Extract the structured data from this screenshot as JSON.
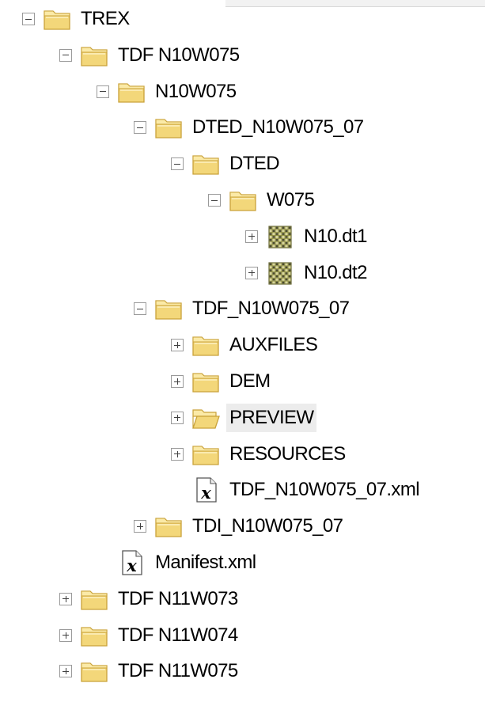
{
  "colors": {
    "folder_body": "#f3d77a",
    "folder_top": "#fbeaa7",
    "folder_outline": "#c9a23a",
    "toggle_border": "#9a9a9a",
    "grid_icon": "#8a8a3a",
    "selection": "#ececec",
    "text": "#000000"
  },
  "tree": {
    "items": [
      {
        "label": "TREX",
        "depth": 0,
        "toggle": "expanded",
        "icon": "folder-icon"
      },
      {
        "label": "TDF N10W075",
        "depth": 1,
        "toggle": "expanded",
        "icon": "folder-icon"
      },
      {
        "label": "N10W075",
        "depth": 2,
        "toggle": "expanded",
        "icon": "folder-icon"
      },
      {
        "label": "DTED_N10W075_07",
        "depth": 3,
        "toggle": "expanded",
        "icon": "folder-icon"
      },
      {
        "label": "DTED",
        "depth": 4,
        "toggle": "expanded",
        "icon": "folder-icon"
      },
      {
        "label": "W075",
        "depth": 5,
        "toggle": "expanded",
        "icon": "folder-icon"
      },
      {
        "label": "N10.dt1",
        "depth": 6,
        "toggle": "collapsed",
        "icon": "raster-grid-icon"
      },
      {
        "label": "N10.dt2",
        "depth": 6,
        "toggle": "collapsed",
        "icon": "raster-grid-icon"
      },
      {
        "label": "TDF_N10W075_07",
        "depth": 3,
        "toggle": "expanded",
        "icon": "folder-icon"
      },
      {
        "label": "AUXFILES",
        "depth": 4,
        "toggle": "collapsed",
        "icon": "folder-icon"
      },
      {
        "label": "DEM",
        "depth": 4,
        "toggle": "collapsed",
        "icon": "folder-icon"
      },
      {
        "label": "PREVIEW",
        "depth": 4,
        "toggle": "collapsed",
        "icon": "folder-open-icon",
        "highlight": true
      },
      {
        "label": "RESOURCES",
        "depth": 4,
        "toggle": "collapsed",
        "icon": "folder-icon"
      },
      {
        "label": "TDF_N10W075_07.xml",
        "depth": 4,
        "toggle": "none",
        "icon": "xml-file-icon"
      },
      {
        "label": "TDI_N10W075_07",
        "depth": 3,
        "toggle": "collapsed",
        "icon": "folder-icon"
      },
      {
        "label": "Manifest.xml",
        "depth": 2,
        "toggle": "none",
        "icon": "xml-file-icon"
      },
      {
        "label": "TDF N11W073",
        "depth": 1,
        "toggle": "collapsed",
        "icon": "folder-icon"
      },
      {
        "label": "TDF N11W074",
        "depth": 1,
        "toggle": "collapsed",
        "icon": "folder-icon"
      },
      {
        "label": "TDF N11W075",
        "depth": 1,
        "toggle": "collapsed",
        "icon": "folder-icon"
      }
    ]
  }
}
